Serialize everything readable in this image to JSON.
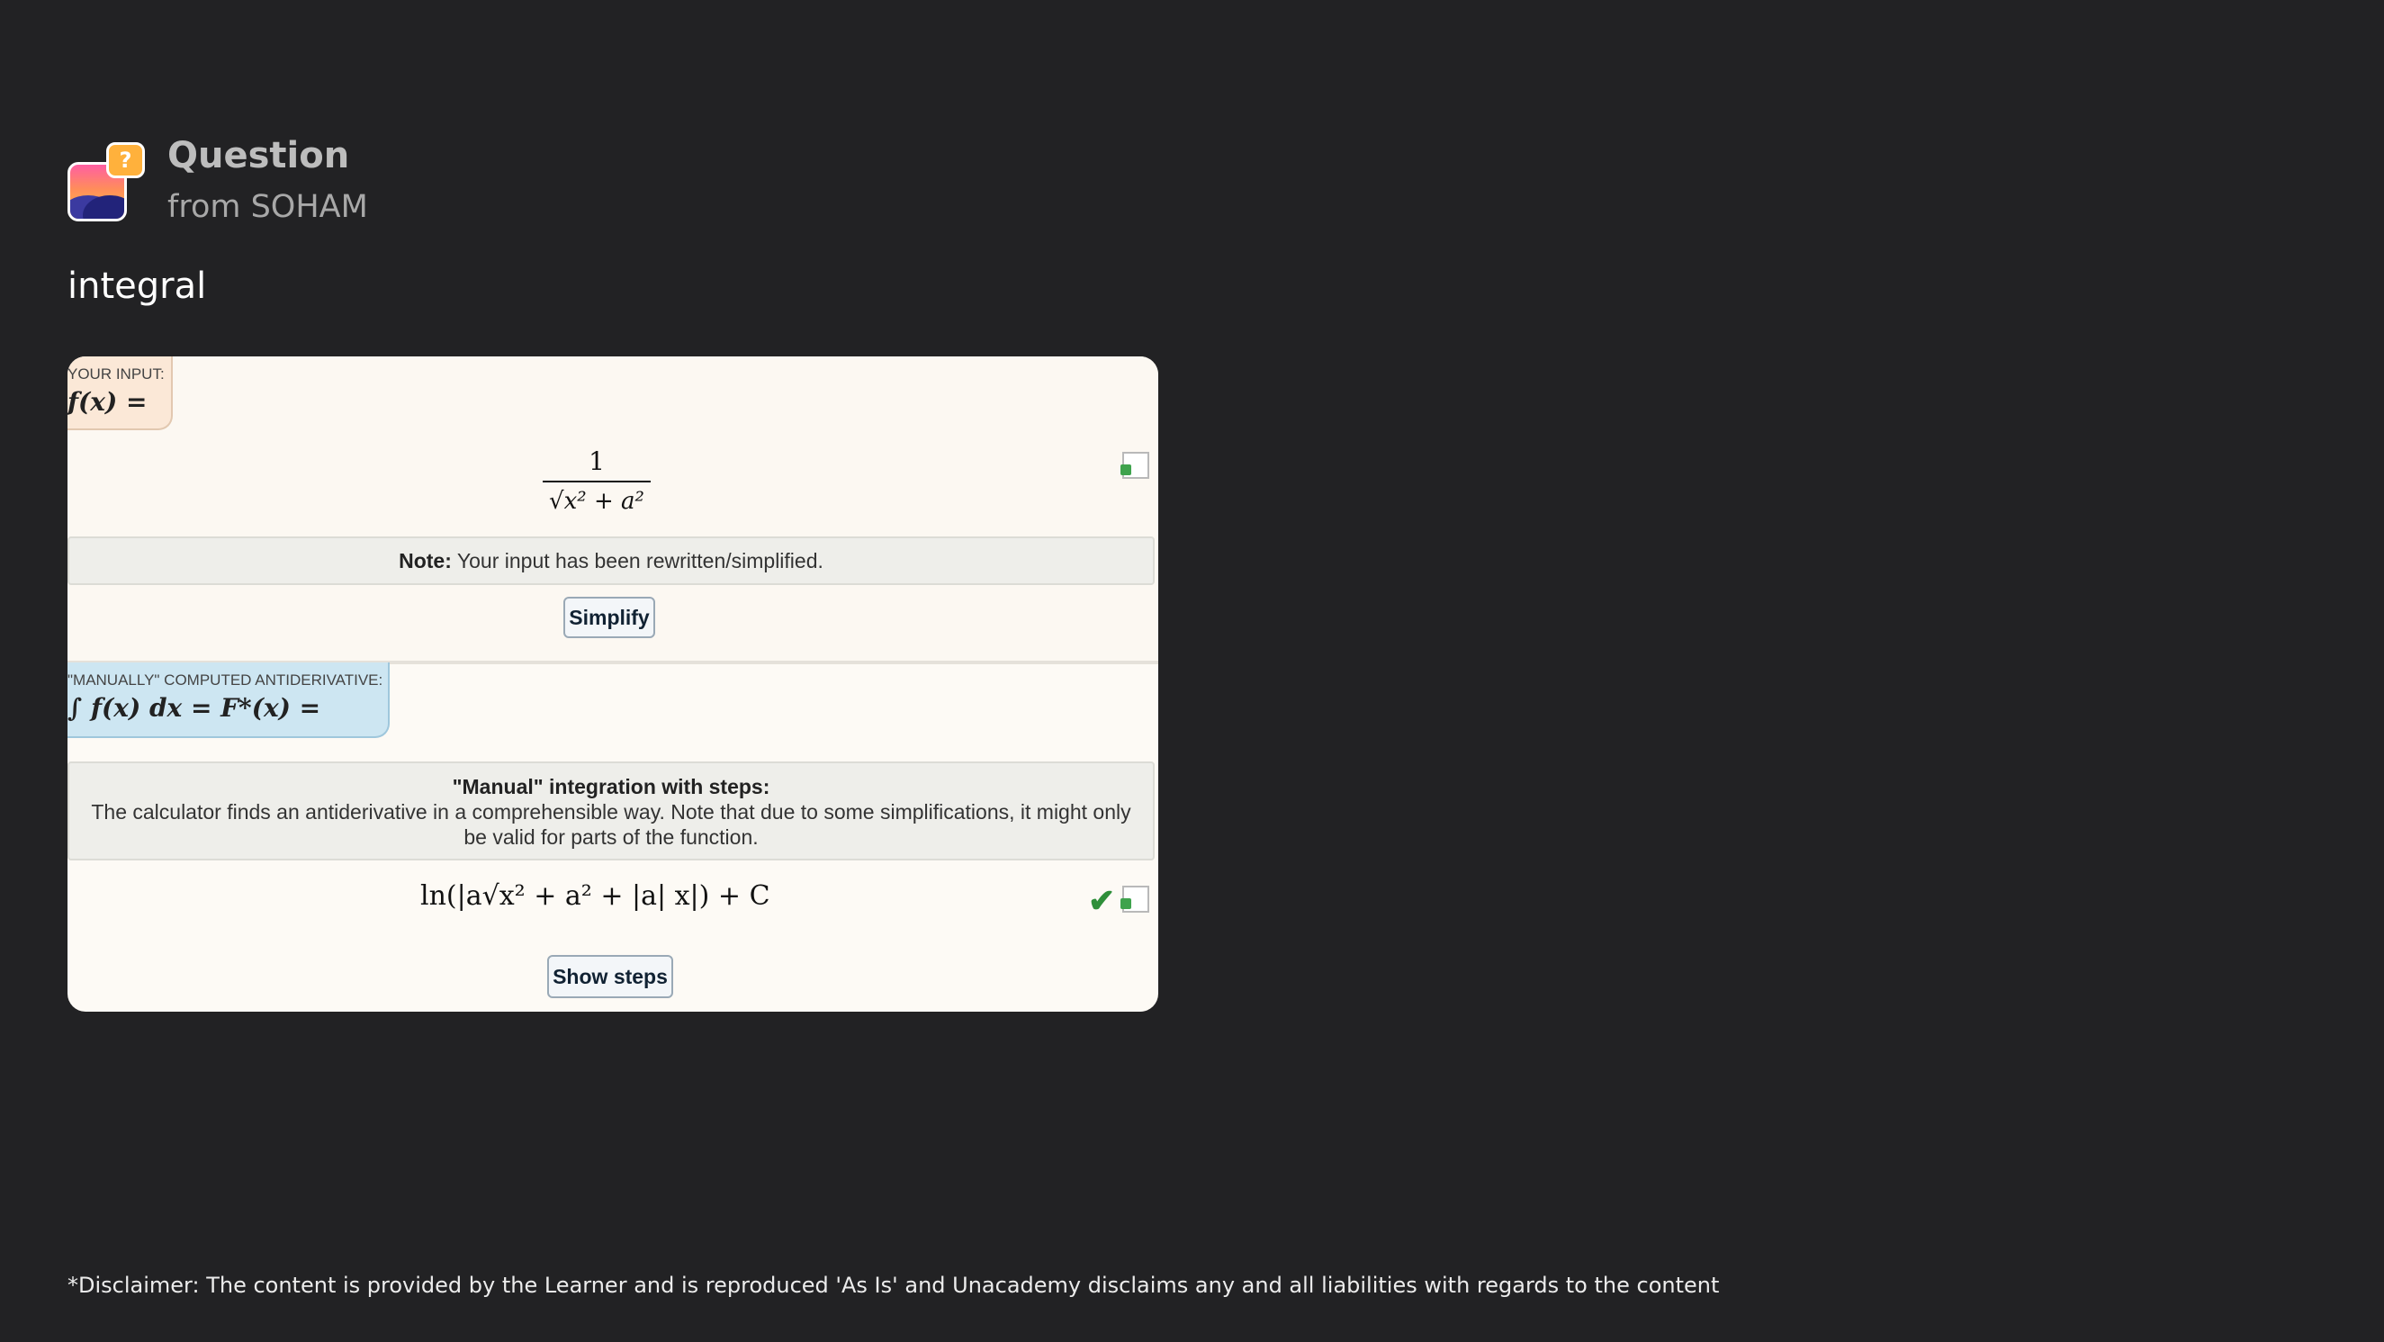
{
  "header": {
    "title": "Question",
    "from": "from SOHAM",
    "badge_glyph": "?"
  },
  "question_text": "integral",
  "card": {
    "input_label": "YOUR INPUT:",
    "input_math": "f(x) =",
    "fraction_numerator": "1",
    "fraction_denominator": "√x² + a²",
    "note_bold": "Note:",
    "note_text": "Your input has been rewritten/simplified.",
    "simplify_label": "Simplify",
    "anti_label": "\"MANUALLY\" COMPUTED ANTIDERIVATIVE:",
    "anti_math": "∫ f(x) dx = F*(x) =",
    "manual_title": "\"Manual\" integration with steps:",
    "manual_body": "The calculator finds an antiderivative in a comprehensible way. Note that due to some simplifications, it might only be valid for parts of the function.",
    "result": "ln(|a√x² + a² + |a| x|) + C",
    "show_steps_label": "Show steps",
    "check_glyph": "✔"
  },
  "disclaimer": "*Disclaimer: The content is provided by the Learner and is reproduced 'As Is' and Unacademy disclaims any and all liabilities with regards to the content",
  "colors": {
    "background": "#222224",
    "card": "#fdfaf5",
    "input_label_bg": "#fbe8d7",
    "anti_label_bg": "#cde6f2",
    "check": "#2f8f3a"
  }
}
